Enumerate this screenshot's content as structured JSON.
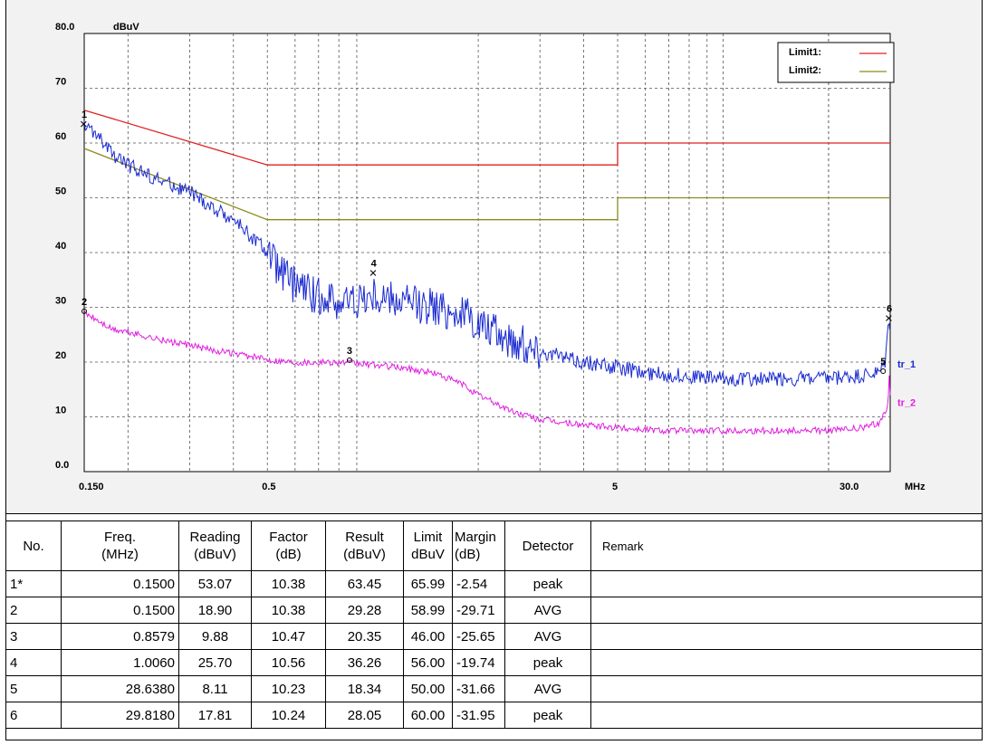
{
  "chart_data": {
    "type": "line",
    "x_scale": "log",
    "y_unit": "dBuV",
    "x_unit": "MHz",
    "xlim": [
      0.15,
      30
    ],
    "ylim": [
      0,
      80
    ],
    "y_ticks": [
      "80.0",
      "70",
      "60",
      "50",
      "40",
      "30",
      "20",
      "10",
      "0.0"
    ],
    "y_tick_values": [
      80,
      70,
      60,
      50,
      40,
      30,
      20,
      10,
      0
    ],
    "x_ticks": [
      "0.150",
      "0.5",
      "5",
      "30.0"
    ],
    "x_tick_values": [
      0.15,
      0.5,
      5,
      30
    ],
    "grid": true,
    "legend": {
      "placement": "top-right",
      "items": [
        {
          "name": "Limit1:",
          "color": "#e02020"
        },
        {
          "name": "Limit2:",
          "color": "#8c8c1e"
        }
      ]
    },
    "series": [
      {
        "name": "Limit1:",
        "color": "#e02020",
        "points": [
          [
            0.15,
            66
          ],
          [
            0.5,
            56
          ],
          [
            5,
            56
          ],
          [
            5,
            60
          ],
          [
            30,
            60
          ]
        ]
      },
      {
        "name": "Limit2:",
        "color": "#8c8c1e",
        "points": [
          [
            0.15,
            59
          ],
          [
            0.5,
            46
          ],
          [
            5,
            46
          ],
          [
            5,
            50
          ],
          [
            30,
            50
          ]
        ]
      },
      {
        "name": "tr_1",
        "color": "#1a2ad0",
        "points": [
          [
            0.15,
            63
          ],
          [
            0.16,
            62
          ],
          [
            0.18,
            58
          ],
          [
            0.2,
            56
          ],
          [
            0.25,
            53
          ],
          [
            0.3,
            51
          ],
          [
            0.35,
            48
          ],
          [
            0.4,
            46
          ],
          [
            0.45,
            43
          ],
          [
            0.5,
            40
          ],
          [
            0.55,
            36
          ],
          [
            0.6,
            34
          ],
          [
            0.7,
            32
          ],
          [
            0.8,
            31
          ],
          [
            1.0,
            32
          ],
          [
            1.2,
            31
          ],
          [
            1.5,
            30
          ],
          [
            1.8,
            29
          ],
          [
            2.0,
            27
          ],
          [
            2.5,
            24
          ],
          [
            3.0,
            22
          ],
          [
            4.0,
            20
          ],
          [
            5.0,
            19
          ],
          [
            6.0,
            18
          ],
          [
            8.0,
            17.5
          ],
          [
            10.0,
            17
          ],
          [
            15.0,
            17
          ],
          [
            20.0,
            17
          ],
          [
            25.0,
            17.5
          ],
          [
            28.0,
            18
          ],
          [
            29.0,
            20
          ],
          [
            29.8,
            28
          ],
          [
            30.0,
            26
          ]
        ]
      },
      {
        "name": "tr_2",
        "color": "#e020e0",
        "points": [
          [
            0.15,
            29
          ],
          [
            0.16,
            28
          ],
          [
            0.18,
            26
          ],
          [
            0.2,
            25.5
          ],
          [
            0.25,
            24
          ],
          [
            0.3,
            23
          ],
          [
            0.4,
            21.5
          ],
          [
            0.5,
            20.5
          ],
          [
            0.6,
            20
          ],
          [
            0.7,
            20
          ],
          [
            0.8,
            20
          ],
          [
            1.0,
            19.5
          ],
          [
            1.2,
            19
          ],
          [
            1.5,
            18
          ],
          [
            1.8,
            16
          ],
          [
            2.0,
            14
          ],
          [
            2.5,
            11
          ],
          [
            3.0,
            9.5
          ],
          [
            4.0,
            8.5
          ],
          [
            5.0,
            8
          ],
          [
            7.0,
            7.5
          ],
          [
            10.0,
            7.5
          ],
          [
            15.0,
            7.5
          ],
          [
            20.0,
            7.5
          ],
          [
            25.0,
            8
          ],
          [
            28.0,
            9
          ],
          [
            29.5,
            12
          ],
          [
            29.8,
            17
          ],
          [
            30.0,
            14
          ]
        ]
      }
    ],
    "trace_labels": [
      {
        "text": "tr_1",
        "series": "tr_1",
        "y": 19
      },
      {
        "text": "tr_2",
        "series": "tr_2",
        "y": 12
      }
    ],
    "markers": [
      {
        "label": "1",
        "symbol": "x",
        "x": 0.15,
        "y": 63.45
      },
      {
        "label": "2",
        "symbol": "o",
        "x": 0.15,
        "y": 29.28
      },
      {
        "label": "3",
        "symbol": "o",
        "x": 0.8579,
        "y": 20.35
      },
      {
        "label": "4",
        "symbol": "x",
        "x": 1.006,
        "y": 36.26
      },
      {
        "label": "5",
        "symbol": "o",
        "x": 28.638,
        "y": 18.34
      },
      {
        "label": "6",
        "symbol": "x",
        "x": 29.818,
        "y": 28.05
      }
    ]
  },
  "table": {
    "headers": [
      {
        "key": "no",
        "label": "No."
      },
      {
        "key": "freq",
        "label": "Freq.\n(MHz)"
      },
      {
        "key": "reading",
        "label": "Reading\n(dBuV)"
      },
      {
        "key": "factor",
        "label": "Factor\n(dB)"
      },
      {
        "key": "result",
        "label": "Result\n(dBuV)"
      },
      {
        "key": "limit",
        "label": "Limit\ndBuV"
      },
      {
        "key": "margin",
        "label": "Margin\n(dB)"
      },
      {
        "key": "detector",
        "label": "Detector"
      },
      {
        "key": "remark",
        "label": "Remark"
      }
    ],
    "rows": [
      {
        "no": "1*",
        "freq": "0.1500",
        "reading": "53.07",
        "factor": "10.38",
        "result": "63.45",
        "limit": "65.99",
        "margin": "-2.54",
        "detector": "peak",
        "remark": ""
      },
      {
        "no": "2",
        "freq": "0.1500",
        "reading": "18.90",
        "factor": "10.38",
        "result": "29.28",
        "limit": "58.99",
        "margin": "-29.71",
        "detector": "AVG",
        "remark": ""
      },
      {
        "no": "3",
        "freq": "0.8579",
        "reading": "9.88",
        "factor": "10.47",
        "result": "20.35",
        "limit": "46.00",
        "margin": "-25.65",
        "detector": "AVG",
        "remark": ""
      },
      {
        "no": "4",
        "freq": "1.0060",
        "reading": "25.70",
        "factor": "10.56",
        "result": "36.26",
        "limit": "56.00",
        "margin": "-19.74",
        "detector": "peak",
        "remark": ""
      },
      {
        "no": "5",
        "freq": "28.6380",
        "reading": "8.11",
        "factor": "10.23",
        "result": "18.34",
        "limit": "50.00",
        "margin": "-31.66",
        "detector": "AVG",
        "remark": ""
      },
      {
        "no": "6",
        "freq": "29.8180",
        "reading": "17.81",
        "factor": "10.24",
        "result": "28.05",
        "limit": "60.00",
        "margin": "-31.95",
        "detector": "peak",
        "remark": ""
      }
    ]
  }
}
